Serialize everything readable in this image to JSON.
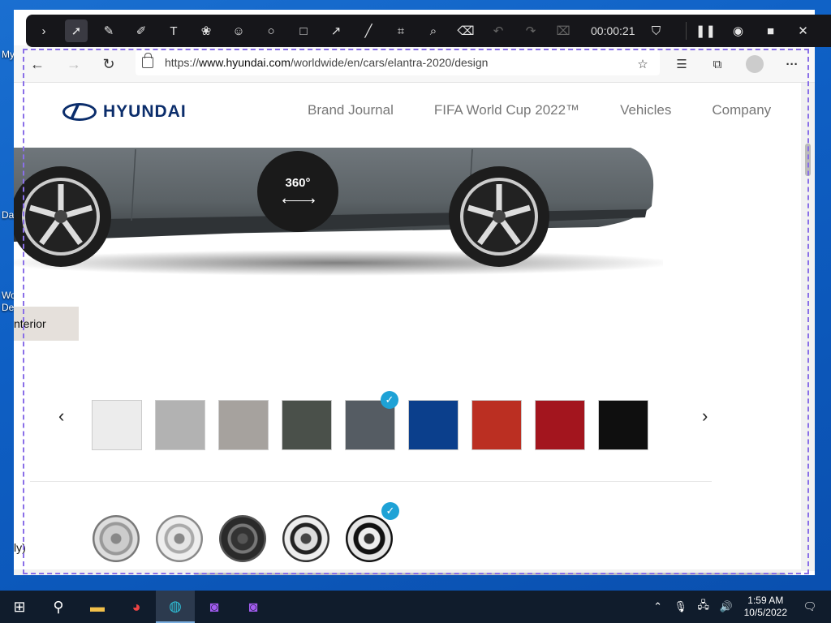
{
  "desktop": {
    "labels": [
      "My",
      "Da",
      "Wo",
      "De"
    ]
  },
  "recorder": {
    "time": "00:00:21",
    "tools": [
      "expand-icon",
      "pointer-icon",
      "pen-icon",
      "highlighter-icon",
      "text-icon",
      "blur-icon",
      "emoji-icon",
      "circle-icon",
      "rectangle-icon",
      "arrow-icon",
      "line-icon",
      "ocr-icon",
      "magnifier-icon",
      "eraser-icon"
    ],
    "controls": [
      "pause-icon",
      "camera-icon",
      "stop-icon",
      "close-icon"
    ]
  },
  "browser": {
    "url_scheme": "https://",
    "url_host": "www.hyundai.com",
    "url_path": "/worldwide/en/cars/elantra-2020/design"
  },
  "site": {
    "brand": "HYUNDAI",
    "nav": [
      "Brand Journal",
      "FIFA World Cup 2022™",
      "Vehicles",
      "Company"
    ],
    "btn_360": "360°",
    "interior_tab": "nterior",
    "side_note": "ly)"
  },
  "colors": {
    "swatches": [
      "#ececec",
      "#b2b2b2",
      "#a6a29e",
      "#4a504a",
      "#555c63",
      "#0b3f8c",
      "#bb2f22",
      "#a3151e",
      "#0f0f0f"
    ],
    "selected_index": 4
  },
  "wheels": {
    "count": 5,
    "selected_index": 4
  },
  "taskbar": {
    "time": "1:59 AM",
    "date": "10/5/2022"
  }
}
